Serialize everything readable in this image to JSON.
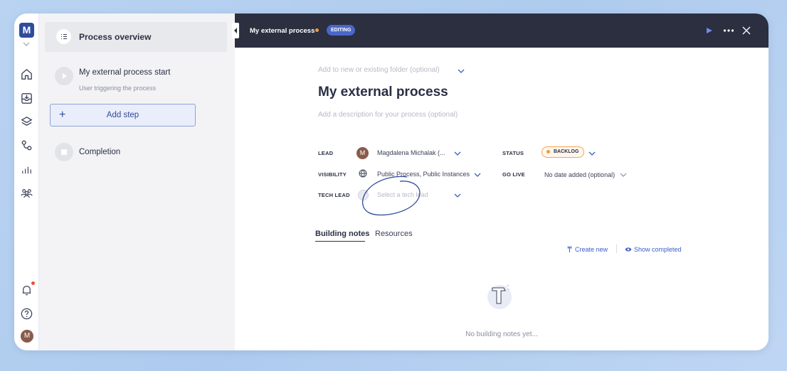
{
  "rail": {
    "logo": "M",
    "avatar": "M",
    "icons": [
      "home-icon",
      "inbox-icon",
      "layers-icon",
      "process-icon",
      "analytics-icon",
      "team-icon",
      "bell-icon",
      "help-icon"
    ]
  },
  "steps": {
    "overview_label": "Process overview",
    "start_title": "My external process start",
    "start_sub": "User triggering the process",
    "add_step": "Add step",
    "completion": "Completion"
  },
  "topbar": {
    "title": "My external process",
    "badge": "EDITING"
  },
  "process": {
    "folder_placeholder": "Add to new or existing folder (optional)",
    "title": "My external process",
    "description_placeholder": "Add a description for your process (optional)"
  },
  "fields": {
    "lead_label": "LEAD",
    "lead_avatar": "M",
    "lead_value": "Magdalena Michalak (...",
    "status_label": "STATUS",
    "status_value": "BACKLOG",
    "visibility_label": "VISIBILITY",
    "visibility_value": "Public Process, Public Instances",
    "golive_label": "GO LIVE",
    "golive_value": "No date added (optional)",
    "techlead_label": "TECH LEAD",
    "techlead_placeholder": "Select a tech lead"
  },
  "tabs": {
    "building_notes": "Building notes",
    "resources": "Resources"
  },
  "actions": {
    "create_new": "Create new",
    "show_completed": "Show completed"
  },
  "empty": {
    "text": "No building notes yet..."
  },
  "colors": {
    "brand": "#2f4b9c",
    "topbar": "#2b2f40",
    "accent_link": "#3b5ec7",
    "status_orange": "#f39a3b",
    "annotation": "#2f4b9c"
  }
}
